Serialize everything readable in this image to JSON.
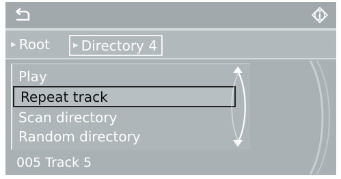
{
  "header": {
    "back_icon": "back-arrow-icon",
    "info_icon": "info-icon"
  },
  "breadcrumb": {
    "items": [
      {
        "label": "Root"
      },
      {
        "label": "Directory 4"
      }
    ]
  },
  "menu": {
    "items": [
      {
        "label": "Play"
      },
      {
        "label": "Repeat track",
        "selected": true
      },
      {
        "label": "Scan directory"
      },
      {
        "label": "Random directory"
      }
    ],
    "scroll_icons": [
      "chevron-up-icon",
      "chevron-down-icon"
    ]
  },
  "status": {
    "now_playing": "005 Track 5"
  },
  "colors": {
    "background": "#a9b1b4",
    "text": "#ffffff",
    "selected_text": "#0d0d0d",
    "selection_border": "#222222"
  }
}
